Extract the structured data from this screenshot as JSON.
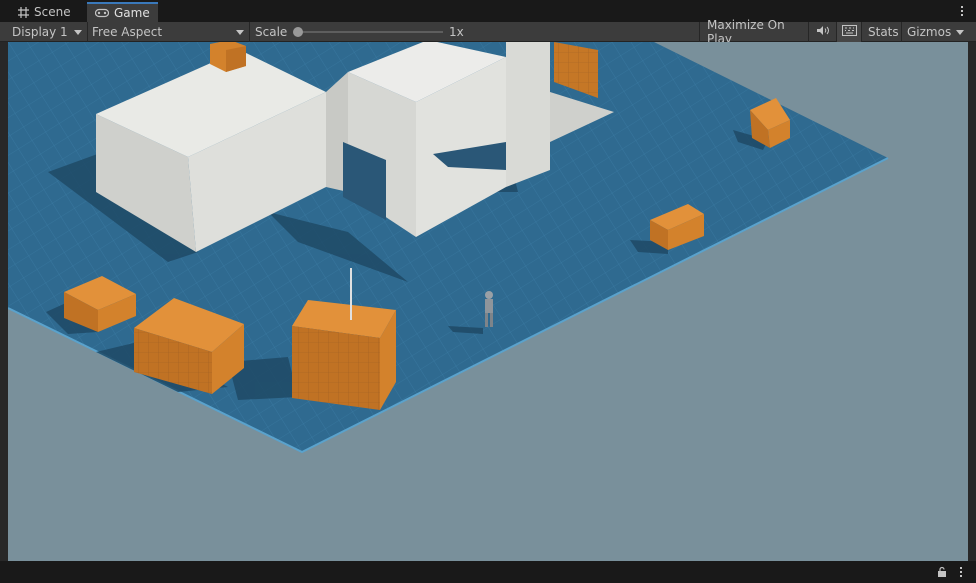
{
  "tabs": [
    {
      "label": "Scene",
      "icon": "grid-icon"
    },
    {
      "label": "Game",
      "icon": "gamepad-icon"
    }
  ],
  "toolbar": {
    "display": "Display 1",
    "aspect": "Free Aspect",
    "scale_label": "Scale",
    "scale_value": "1x",
    "maximize": "Maximize On Play",
    "stats": "Stats",
    "gizmos": "Gizmos"
  },
  "colors": {
    "ground": "#79909b",
    "grid_floor": "#2f6a90",
    "crate": "#d3822c",
    "building": "#dedfdb",
    "accent": "#3a79bb"
  }
}
